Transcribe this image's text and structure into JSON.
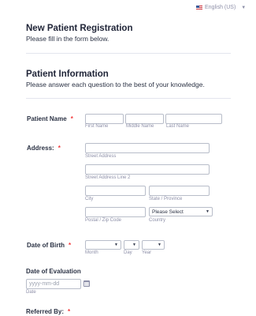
{
  "language": {
    "label": "English (US)",
    "flag_icon": "us-flag-icon"
  },
  "header": {
    "title": "New Patient Registration",
    "subtitle": "Please fill in the form below."
  },
  "section": {
    "title": "Patient Information",
    "subtitle": "Please answer each question to the best of your knowledge."
  },
  "required_marker": "*",
  "fields": {
    "patient_name": {
      "label": "Patient Name",
      "first_value": "",
      "middle_value": "",
      "last_value": "",
      "first_sub": "First Name",
      "middle_sub": "Middle Name",
      "last_sub": "Last Name"
    },
    "address": {
      "label": "Address:",
      "street_sub": "Street Address",
      "street2_sub": "Street Address Line 2",
      "city_sub": "City",
      "state_sub": "State / Province",
      "postal_sub": "Postal / Zip Code",
      "country_sub": "Country",
      "country_selected": "Please Select"
    },
    "dob": {
      "label": "Date of Birth",
      "month_sub": "Month",
      "day_sub": "Day",
      "year_sub": "Year",
      "month_value": "",
      "day_value": "",
      "year_value": ""
    },
    "evaluation": {
      "label": "Date of Evaluation",
      "placeholder": "yyyy-mm-dd",
      "sub": "Date"
    },
    "referred": {
      "label": "Referred By:"
    }
  }
}
